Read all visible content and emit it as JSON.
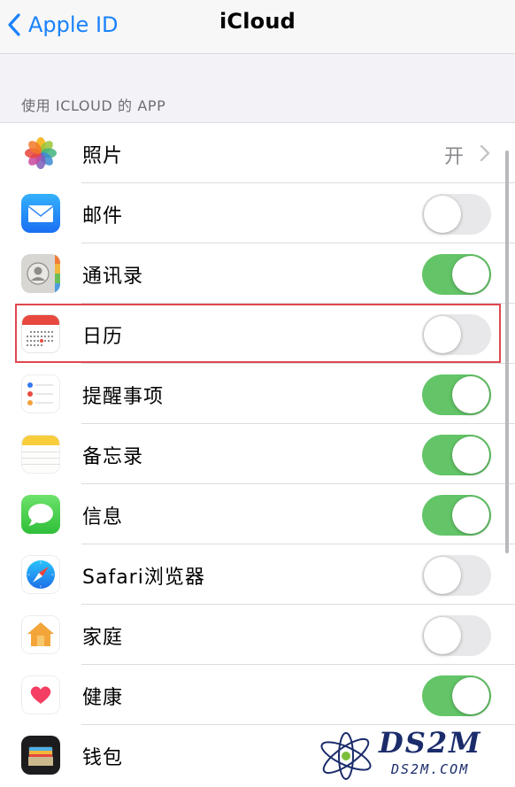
{
  "nav": {
    "back_label": "Apple ID",
    "title": "iCloud"
  },
  "section": {
    "header": "使用 ICLOUD 的 APP"
  },
  "apps": [
    {
      "name": "照片",
      "icon": "photos-icon",
      "value": "开",
      "control": "disclosure"
    },
    {
      "name": "邮件",
      "icon": "mail-icon",
      "control": "toggle",
      "on": false
    },
    {
      "name": "通讯录",
      "icon": "contacts-icon",
      "control": "toggle",
      "on": true
    },
    {
      "name": "日历",
      "icon": "calendar-icon",
      "control": "toggle",
      "on": false,
      "highlighted": true
    },
    {
      "name": "提醒事项",
      "icon": "reminders-icon",
      "control": "toggle",
      "on": true
    },
    {
      "name": "备忘录",
      "icon": "notes-icon",
      "control": "toggle",
      "on": true
    },
    {
      "name": "信息",
      "icon": "messages-icon",
      "control": "toggle",
      "on": true
    },
    {
      "name": "Safari浏览器",
      "icon": "safari-icon",
      "control": "toggle",
      "on": false
    },
    {
      "name": "家庭",
      "icon": "home-icon",
      "control": "toggle",
      "on": false
    },
    {
      "name": "健康",
      "icon": "health-icon",
      "control": "toggle",
      "on": true
    },
    {
      "name": "钱包",
      "icon": "wallet-icon",
      "control": "none"
    }
  ],
  "colors": {
    "accent": "#1a82fb",
    "toggle_on": "#63c567",
    "toggle_off": "#e8e8ea",
    "highlight": "#e0484e"
  },
  "watermark": {
    "text": "DS2M",
    "sub": "DS2M.COM"
  }
}
